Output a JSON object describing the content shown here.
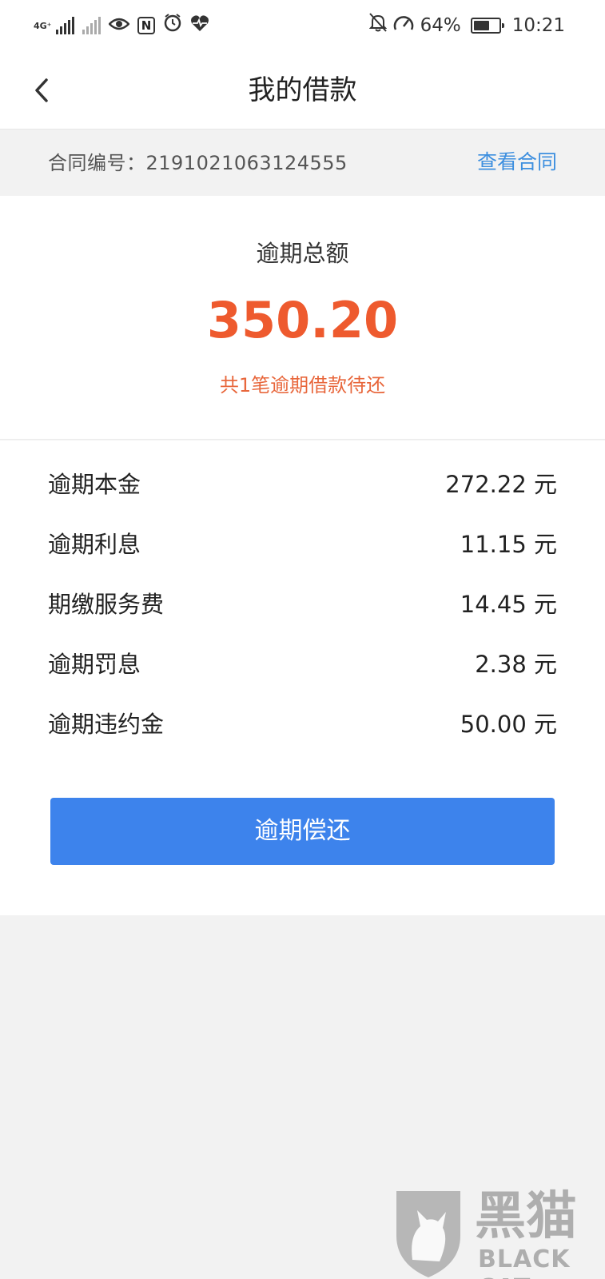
{
  "status_bar": {
    "network_label": "4G⁺",
    "battery_percent": "64%",
    "battery_level": 0.64,
    "time": "10:21",
    "icons": [
      "signal-icon",
      "no-signal-icon",
      "eye-icon",
      "nfc-icon",
      "alarm-icon",
      "heart-rate-icon",
      "mute-icon",
      "speed-icon",
      "battery-icon"
    ]
  },
  "navbar": {
    "title": "我的借款"
  },
  "contract": {
    "label": "合同编号：2191021063124555",
    "link": "查看合同"
  },
  "summary": {
    "title": "逾期总额",
    "amount": "350.20",
    "subtitle": "共1笔逾期借款待还"
  },
  "details": [
    {
      "label": "逾期本金",
      "value": "272.22 元"
    },
    {
      "label": "逾期利息",
      "value": "11.15 元"
    },
    {
      "label": "期缴服务费",
      "value": "14.45 元"
    },
    {
      "label": "逾期罚息",
      "value": "2.38 元"
    },
    {
      "label": "逾期违约金",
      "value": "50.00 元"
    }
  ],
  "action": {
    "button_label": "逾期偿还"
  },
  "watermark": {
    "zh": "黑猫",
    "en": "BLACK CAT"
  },
  "colors": {
    "accent_blue": "#3d83ec",
    "link_blue": "#3d8fdf",
    "overdue_red": "#ee5a2e",
    "background": "#f2f2f2"
  }
}
